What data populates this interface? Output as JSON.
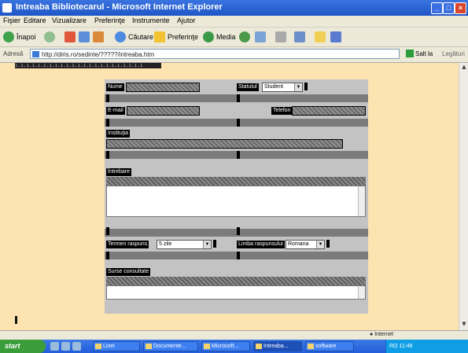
{
  "window": {
    "title": "Intreaba Bibliotecarul - Microsoft Internet Explorer",
    "min_glyph": "_",
    "max_glyph": "□",
    "close_glyph": "×"
  },
  "menu": [
    "Fişier",
    "Editare",
    "Vizualizare",
    "Preferinţe",
    "Instrumente",
    "Ajutor"
  ],
  "toolbar": {
    "back": "Înapoi",
    "search": "Căutare",
    "favorites": "Preferinţe",
    "media": "Media"
  },
  "address": {
    "label": "Adresă",
    "url": "http://diris.ro/sedinte/?????/intreaba.htm",
    "go": "Salt la",
    "links": "Legături"
  },
  "page": {
    "strip_text": "ı.ı.ı.ı.ı.ı.ı.ı.ı.ı.ı.ı.ı.ı.ı.ı.ı.ı.ı.ı.ı.ı.ı",
    "form": {
      "nume_label": "Nume",
      "statutul_label": "Statutul",
      "statutul_value": "Student",
      "email_label": "E-mail",
      "telefon_label": "Telefon",
      "institutia_label": "Instituţia",
      "intrebare_label": "Întrebare",
      "termen_label": "Termen raspuns",
      "termen_value": "5 zile",
      "limba_label": "Limba raspunsului",
      "limba_value": "Romana",
      "surse_label": "Surse consultate"
    }
  },
  "status": {
    "left": "",
    "zone": "Internet"
  },
  "taskbar": {
    "start": "start",
    "tasks": [
      "Linei",
      "Documente...",
      "Microsoft...",
      "Intreaba...",
      "software"
    ],
    "clock": "RO  11:48"
  },
  "colors": {
    "page_bg": "#fde3b0",
    "panel_bg": "#c3c3c3",
    "title_bar": "#1f56c7"
  }
}
